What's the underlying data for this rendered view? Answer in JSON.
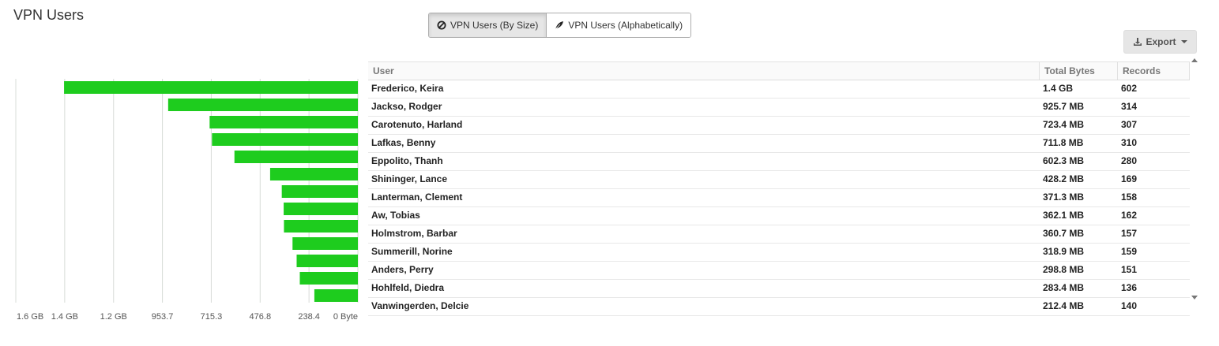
{
  "page": {
    "title": "VPN Users"
  },
  "toggle": {
    "by_size_label": "VPN Users (By Size)",
    "alpha_label": "VPN Users (Alphabetically)",
    "active": "by_size"
  },
  "export": {
    "label": "Export"
  },
  "table": {
    "headers": [
      "User",
      "Total Bytes",
      "Records"
    ],
    "rows": [
      {
        "user": "Frederico, Keira",
        "bytes": "1.4 GB",
        "records": "602"
      },
      {
        "user": "Jackso, Rodger",
        "bytes": "925.7 MB",
        "records": "314"
      },
      {
        "user": "Carotenuto, Harland",
        "bytes": "723.4 MB",
        "records": "307"
      },
      {
        "user": "Lafkas, Benny",
        "bytes": "711.8 MB",
        "records": "310"
      },
      {
        "user": "Eppolito, Thanh",
        "bytes": "602.3 MB",
        "records": "280"
      },
      {
        "user": "Shininger, Lance",
        "bytes": "428.2 MB",
        "records": "169"
      },
      {
        "user": "Lanterman, Clement",
        "bytes": "371.3 MB",
        "records": "158"
      },
      {
        "user": "Aw, Tobias",
        "bytes": "362.1 MB",
        "records": "162"
      },
      {
        "user": "Holmstrom, Barbar",
        "bytes": "360.7 MB",
        "records": "157"
      },
      {
        "user": "Summerill, Norine",
        "bytes": "318.9 MB",
        "records": "159"
      },
      {
        "user": "Anders, Perry",
        "bytes": "298.8 MB",
        "records": "151"
      },
      {
        "user": "Hohlfeld, Diedra",
        "bytes": "283.4 MB",
        "records": "136"
      },
      {
        "user": "Vanwingerden, Delcie",
        "bytes": "212.4 MB",
        "records": "140"
      }
    ]
  },
  "chart_data": {
    "type": "bar",
    "orientation": "horizontal-reversed",
    "unit": "MB",
    "xlim": [
      0,
      1669
    ],
    "tick_values": [
      1669,
      1430.5,
      1192,
      953.7,
      715.3,
      476.8,
      238.4,
      0
    ],
    "tick_labels": [
      "1.6 GB",
      "1.4 GB",
      "1.2 GB",
      "953.7",
      "715.3",
      "476.8",
      "238.4",
      "0 Byte"
    ],
    "grid": true,
    "bar_color": "#1ecc1e",
    "categories": [
      "Frederico, Keira",
      "Jackso, Rodger",
      "Carotenuto, Harland",
      "Lafkas, Benny",
      "Eppolito, Thanh",
      "Shininger, Lance",
      "Lanterman, Clement",
      "Aw, Tobias",
      "Holmstrom, Barbar",
      "Summerill, Norine",
      "Anders, Perry",
      "Hohlfeld, Diedra",
      "Vanwingerden, Delcie"
    ],
    "values": [
      1433.6,
      925.7,
      723.4,
      711.8,
      602.3,
      428.2,
      371.3,
      362.1,
      360.7,
      318.9,
      298.8,
      283.4,
      212.4
    ]
  }
}
